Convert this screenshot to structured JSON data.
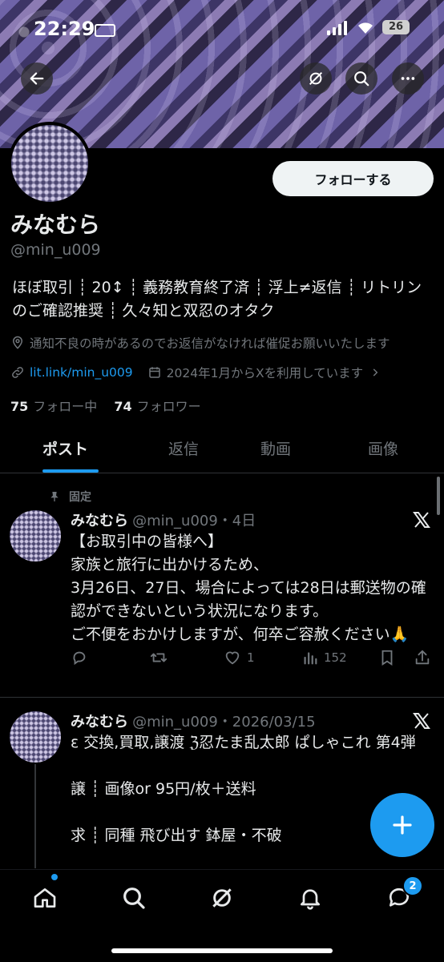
{
  "status_bar": {
    "time": "22:29",
    "battery": "26"
  },
  "profile": {
    "follow_label": "フォローする",
    "name": "みなむら",
    "handle": "@min_u009",
    "bio": "ほぼ取引 ┊ 20↕ ┊ 義務教育終了済 ┊ 浮上≠返信 ┊ リトリンのご確認推奨 ┊ 久々知と双忍のオタク",
    "location": "通知不良の時があるのでお返信がなければ催促お願いいたします",
    "link": "lit.link/min_u009",
    "joined": "2024年1月からXを利用しています",
    "following_count": "75",
    "following_label": "フォロー中",
    "followers_count": "74",
    "followers_label": "フォロワー"
  },
  "tabs": [
    {
      "label": "ポスト"
    },
    {
      "label": "返信"
    },
    {
      "label": "動画"
    },
    {
      "label": "画像"
    }
  ],
  "posts": [
    {
      "pinned_label": "固定",
      "name": "みなむら",
      "handle_time": "@min_u009・4日",
      "text": "【お取引中の皆様へ】\n家族と旅行に出かけるため、\n3月26日、27日、場合によっては28日は郵送物の確認ができないという状況になります。\nご不便をおかけしますが、何卒ご容赦ください🙏",
      "likes": "1",
      "views": "152"
    },
    {
      "name": "みなむら",
      "handle_time": "@min_u009・2026/03/15",
      "text": "ε 交換,買取,譲渡 ℨ忍たま乱太郎 ぱしゃこれ 第4弾\n\n譲 ┊ 画像or 95円/枚＋送料\n\n求 ┊ 同種 飛び出す 鉢屋・不破"
    }
  ],
  "nav": {
    "messages_badge": "2"
  },
  "colors": {
    "accent": "#1d9bf0",
    "background": "#000000",
    "text": "#e7e9ea",
    "muted": "#71767b"
  },
  "icons": [
    "back-arrow-icon",
    "grok-icon",
    "search-icon",
    "more-icon",
    "location-icon",
    "link-icon",
    "calendar-icon",
    "pin-icon",
    "x-logo-icon",
    "reply-icon",
    "repost-icon",
    "like-icon",
    "views-icon",
    "bookmark-icon",
    "share-icon",
    "plus-icon",
    "home-icon",
    "bell-icon",
    "messages-icon"
  ]
}
